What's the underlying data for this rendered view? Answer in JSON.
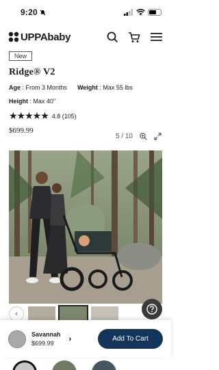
{
  "status": {
    "time": "9:20"
  },
  "header": {
    "logo_text": "UPPAbaby"
  },
  "product": {
    "badge": "New",
    "title": "Ridge® V2",
    "specs": [
      {
        "label": "Age",
        "value": "From 3 Months"
      },
      {
        "label": "Weight",
        "value": "Max 55 lbs"
      },
      {
        "label": "Height",
        "value": "Max 40\""
      }
    ],
    "rating": {
      "stars": "★★★★★",
      "value": "4.8 (105)"
    },
    "price": "$699.99"
  },
  "gallery": {
    "counter": "5 / 10"
  },
  "cart": {
    "color_name": "Savannah",
    "price": "$699.99",
    "add_label": "Add To Cart"
  },
  "colors": {
    "swatches": [
      "#c7c7c7",
      "#6f7a63",
      "#465560"
    ]
  }
}
